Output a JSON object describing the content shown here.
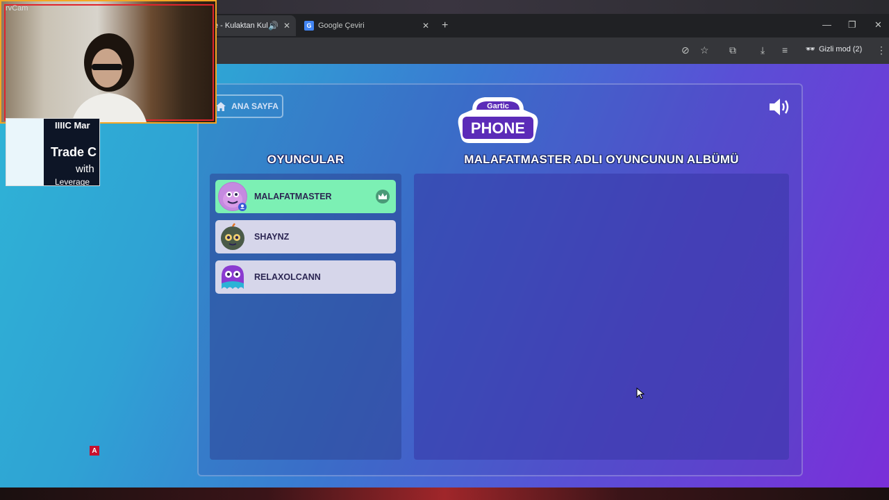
{
  "browser": {
    "tabs": [
      {
        "label": "e - Kulaktan Kul",
        "active": true
      },
      {
        "label": "Google Çeviri",
        "active": false
      }
    ],
    "new_tab": "+",
    "incognito_label": "Gizli mod (2)"
  },
  "overlay": {
    "cam_label": "rvCam",
    "ad_brand": "IIIIC Mar",
    "ad_line1": "Trade C",
    "ad_line2": "with",
    "ad_line3": "Leverage",
    "badge": "A"
  },
  "game": {
    "home_label": "ANA SAYFA",
    "logo_top": "Gartic",
    "logo_bottom": "PHONE",
    "players_heading": "OYUNCULAR",
    "album_heading": "MALAFATMASTER ADLI OYUNCUNUN ALBÜMÜ",
    "players": [
      {
        "name": "MALAFATMASTER",
        "owner": true,
        "you": true
      },
      {
        "name": "SHAYNZ",
        "owner": false,
        "you": false
      },
      {
        "name": "RELAXOLCANN",
        "owner": false,
        "you": false
      }
    ]
  },
  "colors": {
    "owner_row": "#7cf0b4",
    "player_row": "#d6d6ea",
    "tab_bar": "#202124",
    "toolbar": "#35363a"
  }
}
